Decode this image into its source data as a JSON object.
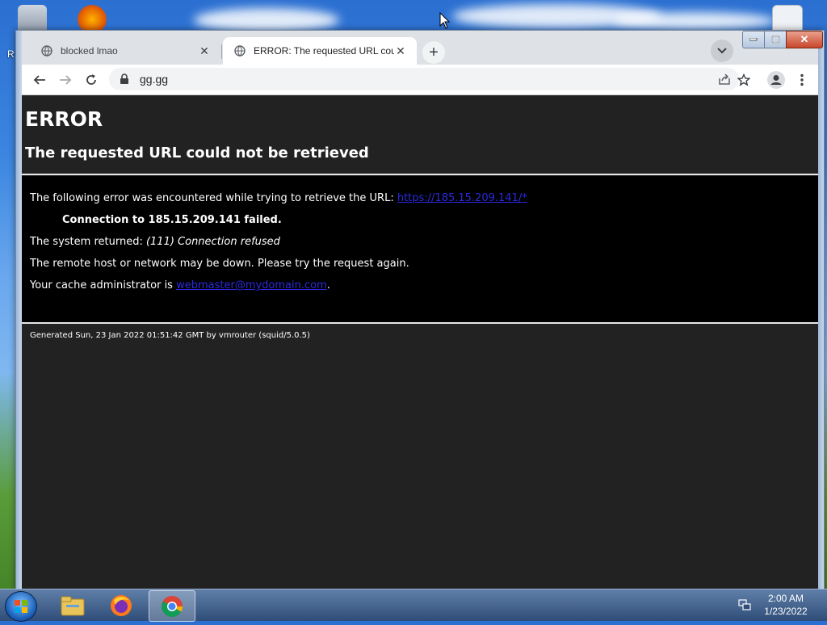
{
  "browser": {
    "tabs": [
      {
        "title": "blocked lmao",
        "active": false
      },
      {
        "title": "ERROR: The requested URL could not be retrieved",
        "active": true
      }
    ],
    "url": "gg.gg"
  },
  "page": {
    "heading": "ERROR",
    "subheading": "The requested URL could not be retrieved",
    "intro": "The following error was encountered while trying to retrieve the URL: ",
    "failed_url": "https://185.15.209.141/*",
    "connection_failed": "Connection to 185.15.209.141 failed.",
    "system_returned_label": "The system returned: ",
    "system_returned_value": "(111) Connection refused",
    "remote_host_msg": "The remote host or network may be down. Please try the request again.",
    "cache_admin_label": "Your cache administrator is ",
    "cache_admin_email": "webmaster@mydomain.com",
    "cache_admin_suffix": ".",
    "footer": "Generated Sun, 23 Jan 2022 01:51:42 GMT by vmrouter (squid/5.0.5)"
  },
  "desktop": {
    "truncated_label": "R"
  },
  "taskbar": {
    "time": "2:00 AM",
    "date": "1/23/2022",
    "items": [
      "explorer-icon",
      "firefox-icon",
      "chrome-icon"
    ]
  },
  "colors": {
    "page_bg": "#222222",
    "error_box_bg": "#000000",
    "link": "#2a2ae0"
  }
}
